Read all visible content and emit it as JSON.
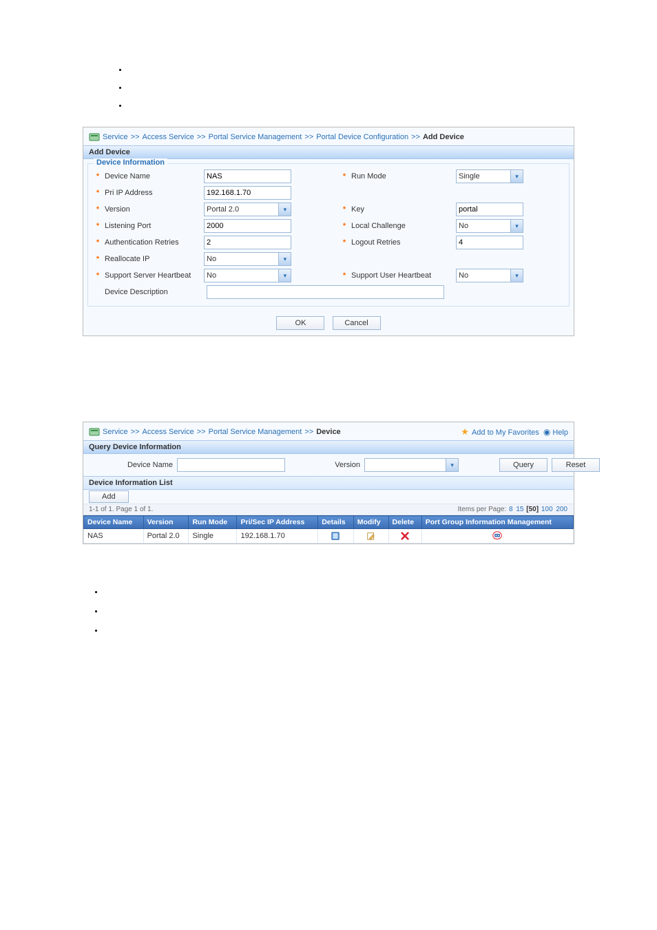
{
  "top_bullets": [
    "",
    "",
    ""
  ],
  "fig1": {
    "breadcrumb": {
      "parts": [
        "Service",
        "Access Service",
        "Portal Service Management",
        "Portal Device Configuration"
      ],
      "last": "Add Device",
      "sep": ">>"
    },
    "title": "Add Device",
    "legend": "Device Information",
    "fields": {
      "device_name_label": "Device Name",
      "device_name_value": "NAS",
      "run_mode_label": "Run Mode",
      "run_mode_value": "Single",
      "pri_ip_label": "Pri IP Address",
      "pri_ip_value": "192.168.1.70",
      "version_label": "Version",
      "version_value": "Portal 2.0",
      "key_label": "Key",
      "key_value": "portal",
      "listening_port_label": "Listening Port",
      "listening_port_value": "2000",
      "local_challenge_label": "Local Challenge",
      "local_challenge_value": "No",
      "auth_retries_label": "Authentication Retries",
      "auth_retries_value": "2",
      "logout_retries_label": "Logout Retries",
      "logout_retries_value": "4",
      "reallocate_ip_label": "Reallocate IP",
      "reallocate_ip_value": "No",
      "support_server_hb_label": "Support Server Heartbeat",
      "support_server_hb_value": "No",
      "support_user_hb_label": "Support User Heartbeat",
      "support_user_hb_value": "No",
      "device_desc_label": "Device Description",
      "device_desc_value": ""
    },
    "buttons": {
      "ok": "OK",
      "cancel": "Cancel"
    }
  },
  "fig2": {
    "breadcrumb": {
      "parts": [
        "Service",
        "Access Service",
        "Portal Service Management"
      ],
      "last": "Device",
      "sep": ">>"
    },
    "fav": "Add to My Favorites",
    "help": "Help",
    "querybar_title": "Query Device Information",
    "query": {
      "device_name_label": "Device Name",
      "device_name_value": "",
      "version_label": "Version",
      "version_value": "",
      "query_btn": "Query",
      "reset_btn": "Reset"
    },
    "listbar_title": "Device Information List",
    "add_btn": "Add",
    "page_left": "1-1 of 1. Page 1 of 1.",
    "page_right_label": "Items per Page:",
    "page_sizes": [
      "8",
      "15",
      "[50]",
      "100",
      "200"
    ],
    "columns": [
      "Device Name",
      "Version",
      "Run Mode",
      "Pri/Sec IP Address",
      "Details",
      "Modify",
      "Delete",
      "Port Group Information Management"
    ],
    "row": {
      "device_name": "NAS",
      "version": "Portal 2.0",
      "run_mode": "Single",
      "ip": "192.168.1.70"
    }
  },
  "underline1": " ",
  "underline2": " ",
  "bottom_bullets": [
    "",
    "",
    ""
  ]
}
